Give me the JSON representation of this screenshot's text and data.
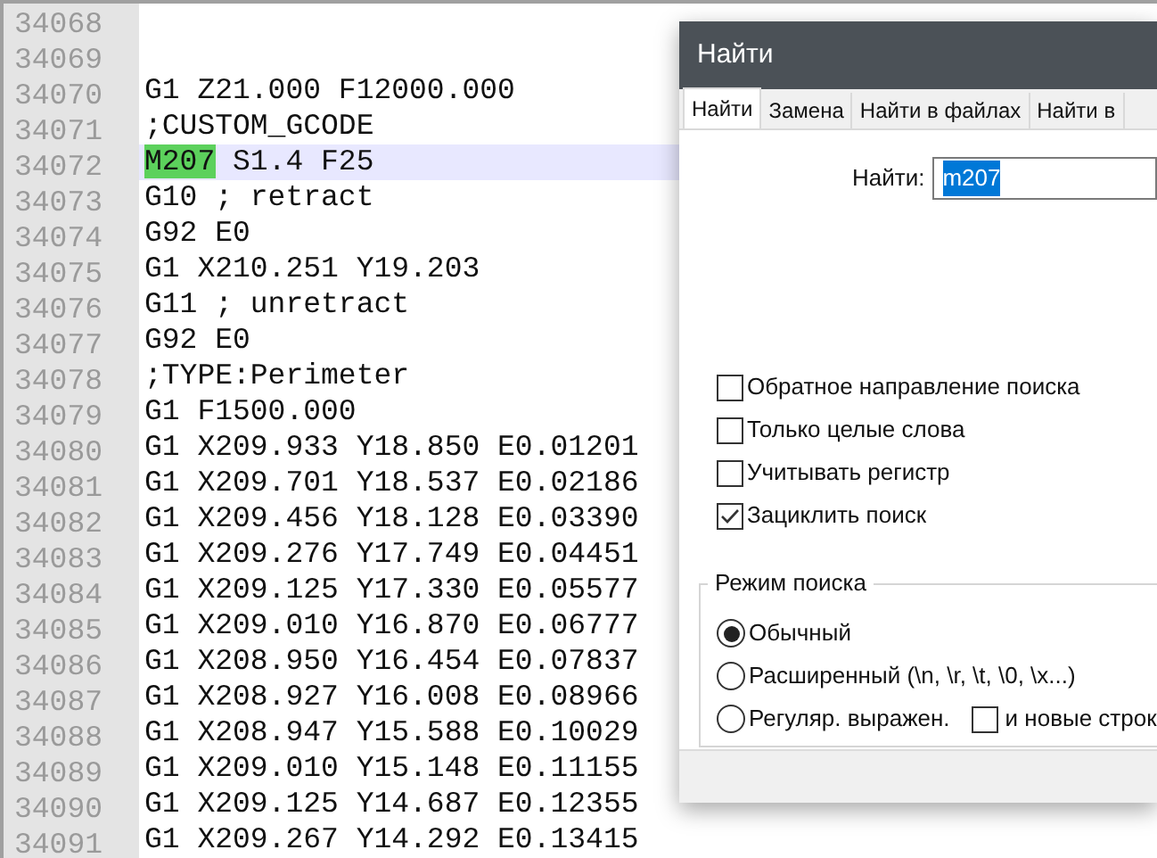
{
  "editor": {
    "lines": [
      {
        "number": "34068"
      },
      {
        "number": "34069"
      },
      {
        "number": "34070",
        "text": "G1 Z21.000 F12000.000"
      },
      {
        "number": "34071",
        "text": ";CUSTOM_GCODE"
      },
      {
        "number": "34072",
        "current": true,
        "segments": [
          {
            "text": "M207",
            "match": true
          },
          {
            "text": " S1.4 F25",
            "match": false
          }
        ]
      },
      {
        "number": "34073",
        "text": "G10 ; retract"
      },
      {
        "number": "34074",
        "text": "G92 E0"
      },
      {
        "number": "34075",
        "text": "G1 X210.251 Y19.203"
      },
      {
        "number": "34076",
        "text": "G11 ; unretract"
      },
      {
        "number": "34077",
        "text": "G92 E0"
      },
      {
        "number": "34078",
        "text": ";TYPE:Perimeter"
      },
      {
        "number": "34079",
        "text": "G1 F1500.000"
      },
      {
        "number": "34080",
        "text": "G1 X209.933 Y18.850 E0.01201"
      },
      {
        "number": "34081",
        "text": "G1 X209.701 Y18.537 E0.02186"
      },
      {
        "number": "34082",
        "text": "G1 X209.456 Y18.128 E0.03390"
      },
      {
        "number": "34083",
        "text": "G1 X209.276 Y17.749 E0.04451"
      },
      {
        "number": "34084",
        "text": "G1 X209.125 Y17.330 E0.05577"
      },
      {
        "number": "34085",
        "text": "G1 X209.010 Y16.870 E0.06777"
      },
      {
        "number": "34086",
        "text": "G1 X208.950 Y16.454 E0.07837"
      },
      {
        "number": "34087",
        "text": "G1 X208.927 Y16.008 E0.08966"
      },
      {
        "number": "34088",
        "text": "G1 X208.947 Y15.588 E0.10029"
      },
      {
        "number": "34089",
        "text": "G1 X209.010 Y15.148 E0.11155"
      },
      {
        "number": "34090",
        "text": "G1 X209.125 Y14.687 E0.12355"
      },
      {
        "number": "34091",
        "text": "G1 X209.267 Y14.292 E0.13415"
      }
    ]
  },
  "dialog": {
    "title": "Найти",
    "tabs": [
      {
        "label": "Найти",
        "selected": true
      },
      {
        "label": "Замена",
        "selected": false
      },
      {
        "label": "Найти в файлах",
        "selected": false
      },
      {
        "label": "Найти в",
        "selected": false
      }
    ],
    "find_label": "Найти:",
    "find_value": "m207",
    "options": [
      {
        "label": "Обратное направление поиска",
        "checked": false
      },
      {
        "label": "Только целые слова",
        "checked": false
      },
      {
        "label": "Учитывать регистр",
        "checked": false
      },
      {
        "label": "Зациклить поиск",
        "checked": true
      }
    ],
    "search_mode": {
      "title": "Режим поиска",
      "modes": [
        {
          "label": "Обычный",
          "selected": true
        },
        {
          "label": "Расширенный (\\n, \\r, \\t, \\0, \\x...)",
          "selected": false
        },
        {
          "label": "Регуляр. выражен.",
          "selected": false
        }
      ],
      "newline_option": {
        "label": "и новые строк",
        "checked": false
      }
    }
  }
}
